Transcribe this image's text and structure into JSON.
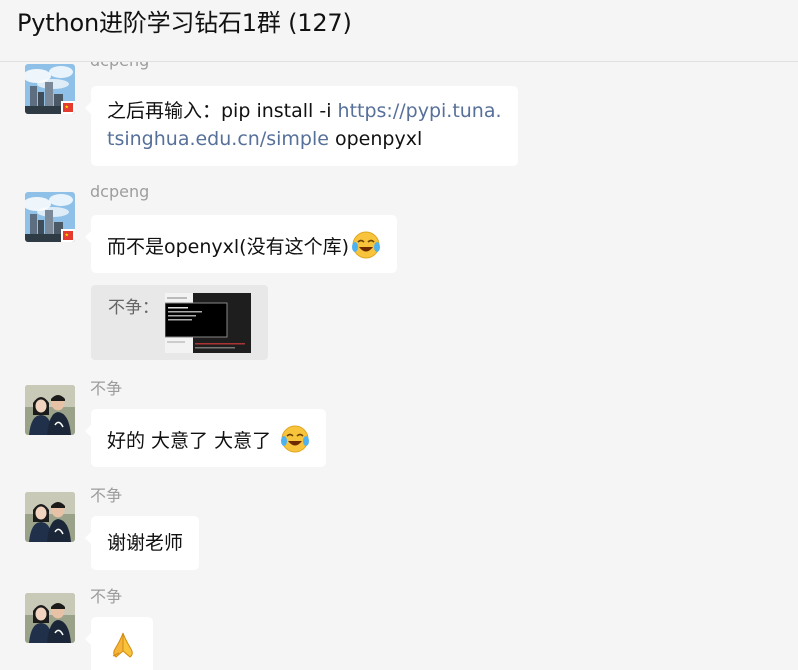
{
  "window": {
    "title": "Python进阶学习钻石1群 (127)"
  },
  "messages": [
    {
      "sender": "dcpeng",
      "avatar": "city-skyline-avatar",
      "line1_text": "之后再输入：pip install -i ",
      "line1_link": "https://pypi.tuna.",
      "line2_link": "tsinghua.edu.cn/simple",
      "line2_text": " openpyxl"
    },
    {
      "sender": "dcpeng",
      "avatar": "city-skyline-avatar",
      "text": "而不是openyxl(没有这个库)",
      "emoji": "tears-of-joy-emoji"
    },
    {
      "quote_label": "不争：",
      "quote_thumb": "terminal-screenshot-thumbnail"
    },
    {
      "sender": "不争",
      "avatar": "couple-photo-avatar",
      "text": "好的 大意了 大意了",
      "emoji": "tears-of-joy-emoji"
    },
    {
      "sender": "不争",
      "avatar": "couple-photo-avatar",
      "text": "谢谢老师"
    },
    {
      "sender": "不争",
      "avatar": "couple-photo-avatar",
      "emoji": "folded-hands-emoji"
    }
  ],
  "colors": {
    "background": "#f5f5f5",
    "bubble": "#ffffff",
    "link": "#57709a",
    "sender": "#9d9d9d"
  }
}
